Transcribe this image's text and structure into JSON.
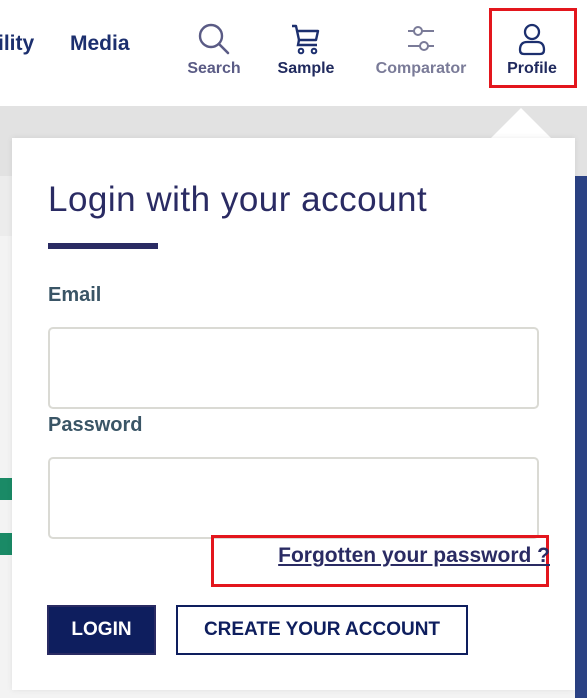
{
  "header": {
    "nav_links": [
      {
        "label": "ility"
      },
      {
        "label": "Media"
      }
    ],
    "utilities": [
      {
        "id": "search",
        "label": "Search",
        "icon": "search-icon"
      },
      {
        "id": "sample",
        "label": "Sample",
        "icon": "cart-icon"
      },
      {
        "id": "comparator",
        "label": "Comparator",
        "icon": "sliders-icon"
      },
      {
        "id": "profile",
        "label": "Profile",
        "icon": "user-icon",
        "highlighted": true
      }
    ]
  },
  "login_popup": {
    "title": "Login with your account",
    "email_label": "Email",
    "email_value": "",
    "password_label": "Password",
    "password_value": "",
    "forgot_password": "Forgotten your password ?",
    "login_button": "LOGIN",
    "create_account_button": "CREATE YOUR ACCOUNT"
  },
  "colors": {
    "brand_navy": "#0e1e5e",
    "title_purple": "#2a2b63",
    "label_slate": "#3a5566",
    "highlight_red": "#e3161d",
    "side_blue": "#2b4284",
    "accent_green": "#1a8a66"
  }
}
